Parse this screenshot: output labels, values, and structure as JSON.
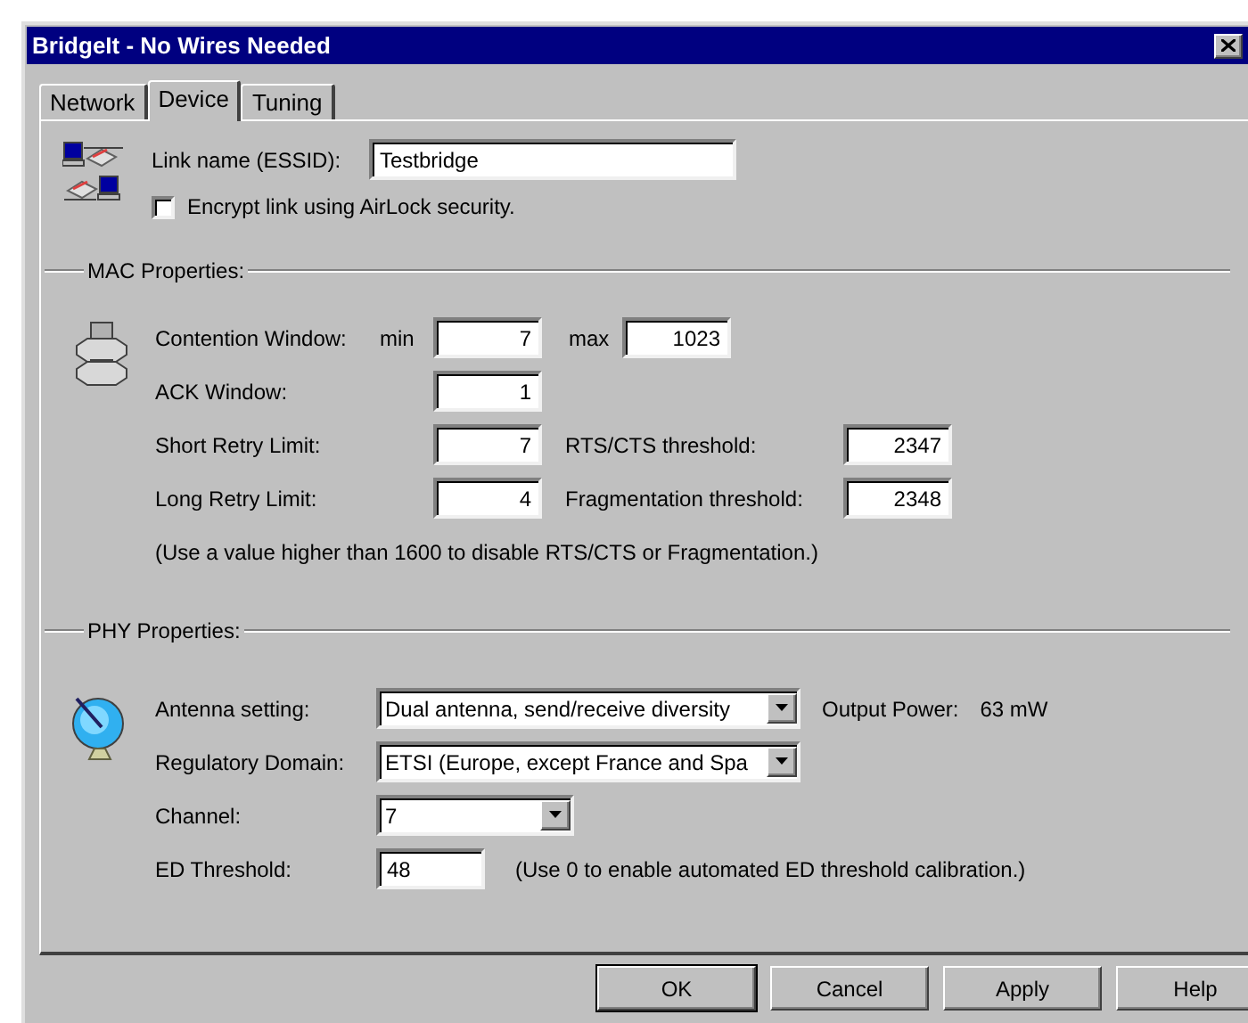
{
  "window": {
    "title": "BridgeIt - No Wires Needed"
  },
  "tabs": [
    {
      "label": "Network",
      "selected": false
    },
    {
      "label": "Device",
      "selected": true
    },
    {
      "label": "Tuning",
      "selected": false
    }
  ],
  "link_name": {
    "label": "Link name (ESSID):",
    "value": "Testbridge"
  },
  "encrypt": {
    "label": "Encrypt link using AirLock security.",
    "checked": false
  },
  "mac_properties": {
    "title": "MAC Properties:",
    "rows": [
      {
        "kind": "range",
        "label": "Contention Window:",
        "prefix": "min",
        "value": "7",
        "second_label": "max",
        "second_value": "1023"
      },
      {
        "kind": "single",
        "label": "ACK Window:",
        "value": "1"
      },
      {
        "kind": "threshold",
        "label": "Short Retry Limit:",
        "value": "7",
        "second_label": "RTS/CTS threshold:",
        "second_value": "2347"
      },
      {
        "kind": "threshold",
        "label": "Long Retry Limit:",
        "value": "4",
        "second_label": "Fragmentation threshold:",
        "second_value": "2348"
      }
    ],
    "note": "(Use a value higher than 1600 to disable RTS/CTS or Fragmentation.)"
  },
  "phy_properties": {
    "title": "PHY Properties:",
    "rows": [
      {
        "kind": "wide_combo",
        "label": "Antenna setting:",
        "value": "Dual antenna, send/receive diversity",
        "after_label": "Output Power:",
        "after_value": "63 mW"
      },
      {
        "kind": "wide_combo",
        "label": "Regulatory Domain:",
        "value": "ETSI (Europe, except France and Spa"
      },
      {
        "kind": "short_combo",
        "label": "Channel:",
        "value": "7"
      },
      {
        "kind": "input",
        "label": "ED Threshold:",
        "value": "48",
        "note": "(Use 0 to enable automated ED threshold calibration.)"
      }
    ]
  },
  "buttons": [
    {
      "label": "OK",
      "default": true
    },
    {
      "label": "Cancel",
      "default": false
    },
    {
      "label": "Apply",
      "default": false
    },
    {
      "label": "Help",
      "default": false
    }
  ]
}
